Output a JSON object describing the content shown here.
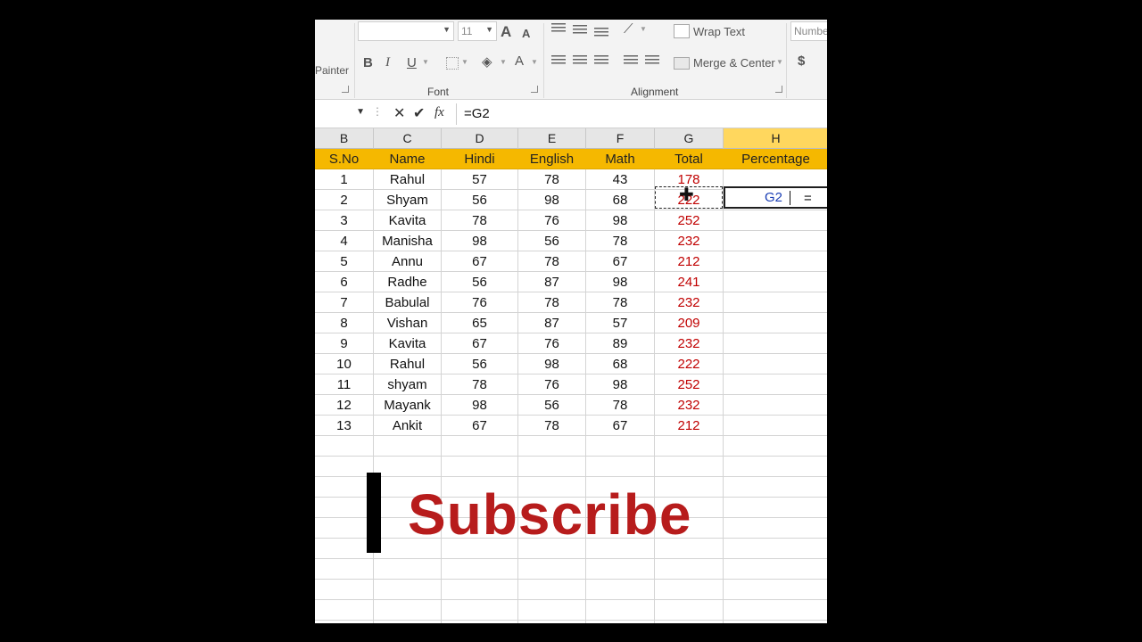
{
  "ribbon": {
    "painter_label": "Painter",
    "font_size": "11",
    "font_group_label": "Font",
    "alignment_group_label": "Alignment",
    "wrap_text_label": "Wrap Text",
    "merge_center_label": "Merge & Center",
    "number_label": "Number",
    "currency_symbol": "$",
    "bold": "B",
    "italic": "I",
    "underline": "U",
    "increase_font": "A",
    "decrease_font": "A",
    "font_color": "A"
  },
  "formula_bar": {
    "formula": "=G2",
    "fx": "fx"
  },
  "columns": [
    "B",
    "C",
    "D",
    "E",
    "F",
    "G",
    "H"
  ],
  "active_column": "H",
  "table": {
    "headers": [
      "S.No",
      "Name",
      "Hindi",
      "English",
      "Math",
      "Total",
      "Percentage"
    ],
    "rows": [
      [
        "1",
        "Rahul",
        "57",
        "78",
        "43",
        "178",
        "=G2"
      ],
      [
        "2",
        "Shyam",
        "56",
        "98",
        "68",
        "222",
        ""
      ],
      [
        "3",
        "Kavita",
        "78",
        "76",
        "98",
        "252",
        ""
      ],
      [
        "4",
        "Manisha",
        "98",
        "56",
        "78",
        "232",
        ""
      ],
      [
        "5",
        "Annu",
        "67",
        "78",
        "67",
        "212",
        ""
      ],
      [
        "6",
        "Radhe",
        "56",
        "87",
        "98",
        "241",
        ""
      ],
      [
        "7",
        "Babulal",
        "76",
        "78",
        "78",
        "232",
        ""
      ],
      [
        "8",
        "Vishan",
        "65",
        "87",
        "57",
        "209",
        ""
      ],
      [
        "9",
        "Kavita",
        "67",
        "76",
        "89",
        "232",
        ""
      ],
      [
        "10",
        "Rahul",
        "56",
        "98",
        "68",
        "222",
        ""
      ],
      [
        "11",
        "shyam",
        "78",
        "76",
        "98",
        "252",
        ""
      ],
      [
        "12",
        "Mayank",
        "98",
        "56",
        "78",
        "232",
        ""
      ],
      [
        "13",
        "Ankit",
        "67",
        "78",
        "67",
        "212",
        ""
      ]
    ]
  },
  "active_cell": {
    "eq": "=",
    "ref": "G2"
  },
  "overlay": {
    "text": "Subscribe"
  },
  "colors": {
    "title_row": "#f5b800",
    "total_text": "#c00000",
    "subscribe": "#b71c1c",
    "ref_text": "#1a3eb5"
  }
}
